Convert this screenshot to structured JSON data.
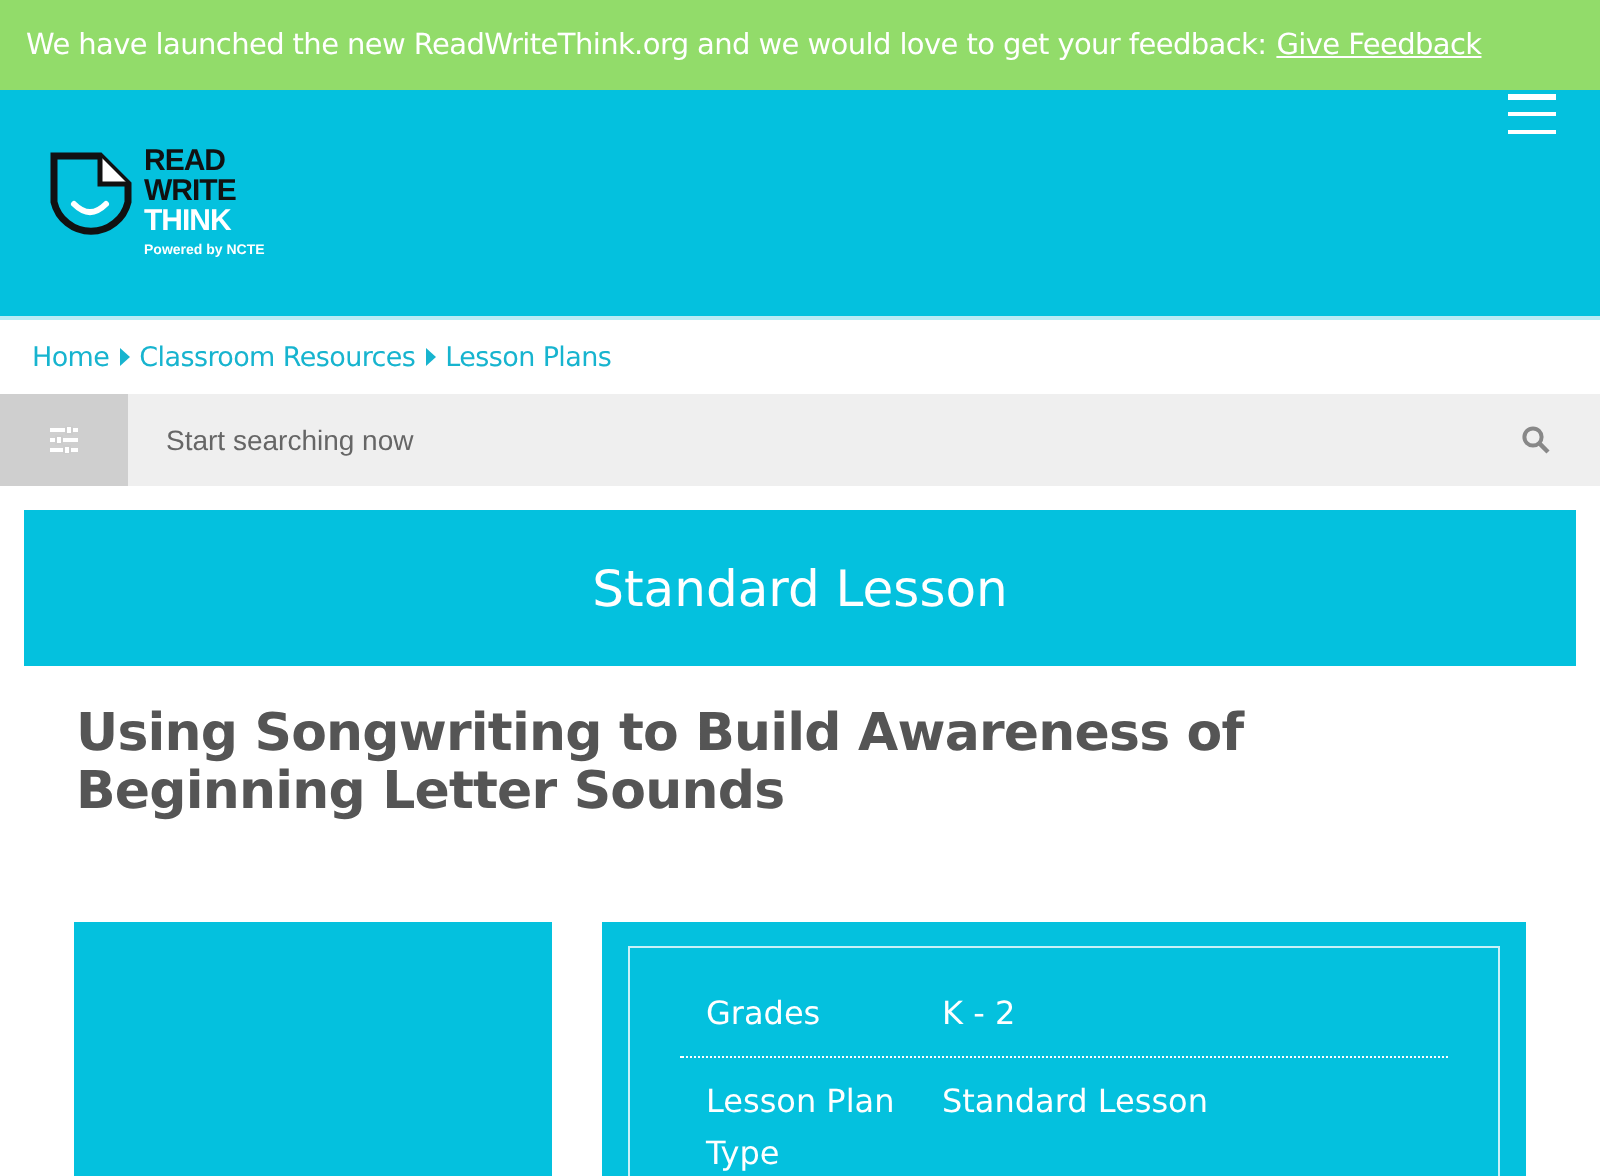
{
  "announcement": {
    "text": "We have launched the new ReadWriteThink.org and we would love to get your feedback:",
    "link": "Give Feedback"
  },
  "logo": {
    "lines": [
      "READ",
      "WRITE",
      "THINK"
    ],
    "tagline": "Powered by NCTE"
  },
  "breadcrumbs": [
    "Home",
    "Classroom Resources",
    "Lesson Plans"
  ],
  "search": {
    "placeholder": "Start searching now"
  },
  "lesson_type_banner": "Standard Lesson",
  "title": "Using Songwriting to Build Awareness of Beginning Letter Sounds",
  "details": [
    {
      "label": "Grades",
      "value": "K - 2"
    },
    {
      "label": "Lesson Plan Type",
      "value": "Standard Lesson"
    }
  ]
}
